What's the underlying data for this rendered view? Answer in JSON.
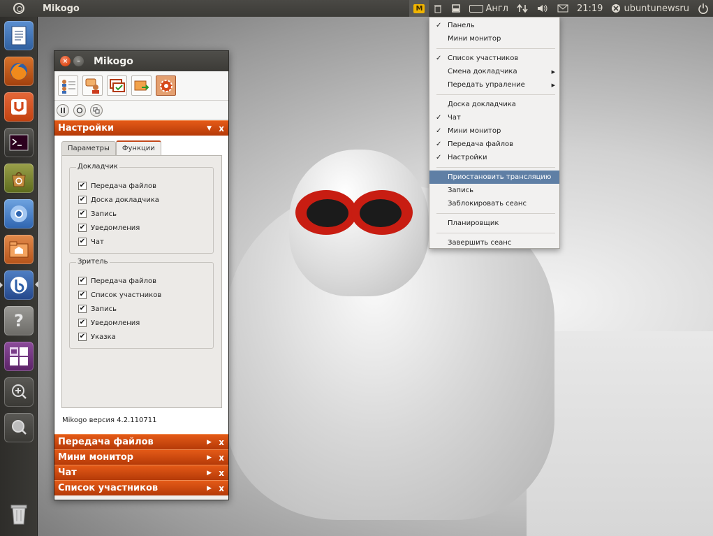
{
  "top_panel": {
    "app_title": "Mikogo",
    "keyboard_layout": "Англ",
    "clock": "21:19",
    "user": "ubuntunewsru",
    "m_indicator": "M"
  },
  "launcher": {
    "items": [
      "libreoffice-writer-icon",
      "firefox-icon",
      "ubuntu-one-icon",
      "terminal-icon",
      "software-center-icon",
      "chromium-icon",
      "home-folder-icon",
      "mikogo-icon",
      "help-icon",
      "workspace-switcher-icon",
      "zoom-in-icon",
      "zoom-icon",
      "trash-icon"
    ]
  },
  "mikogo_window": {
    "title": "Mikogo",
    "toolbar_icons": [
      "participants-icon",
      "switch-presenter-icon",
      "whiteboard-icon",
      "transfer-icon",
      "settings-gear-icon"
    ],
    "controls": [
      "pause-icon",
      "record-icon",
      "copy-icon"
    ],
    "settings_header": "Настройки",
    "tabs": [
      "Параметры",
      "Функции"
    ],
    "selected_tab": "Функции",
    "presenter_group": {
      "title": "Докладчик",
      "items": [
        "Передача файлов",
        "Доска докладчика",
        "Запись",
        "Уведомления",
        "Чат"
      ]
    },
    "viewer_group": {
      "title": "Зритель",
      "items": [
        "Передача файлов",
        "Список участников",
        "Запись",
        "Уведомления",
        "Указка"
      ]
    },
    "check_mark": "✔",
    "version": "Mikogo версия 4.2.110711",
    "collapsed_sections": [
      "Передача файлов",
      "Мини монитор",
      "Чат",
      "Список участников"
    ],
    "close_symbol": "x"
  },
  "menu": {
    "items": [
      {
        "label": "Панель",
        "checked": true
      },
      {
        "label": "Мини монитор",
        "checked": false
      },
      {
        "label": "Список участников",
        "checked": true
      },
      {
        "label": "Смена докладчика",
        "checked": false,
        "submenu": true
      },
      {
        "label": "Передать упраление",
        "checked": false,
        "submenu": true
      },
      {
        "label": "Доска докладчика",
        "checked": false
      },
      {
        "label": "Чат",
        "checked": true
      },
      {
        "label": "Мини монитор",
        "checked": true
      },
      {
        "label": "Передача файлов",
        "checked": true
      },
      {
        "label": "Настройки",
        "checked": true
      },
      {
        "label": "Приостановить трансляцию",
        "checked": false,
        "highlighted": true
      },
      {
        "label": "Запись",
        "checked": false
      },
      {
        "label": "Заблокировать сеанс",
        "checked": false
      },
      {
        "label": "Планировщик",
        "checked": false
      },
      {
        "label": "Завершить сеанс",
        "checked": false
      }
    ],
    "check_symbol": "✓",
    "submenu_symbol": "▶"
  },
  "colors": {
    "panel": "#3c3b37",
    "accent_orange": "#d14c0f",
    "menu_highlight": "#5f7fa5"
  }
}
